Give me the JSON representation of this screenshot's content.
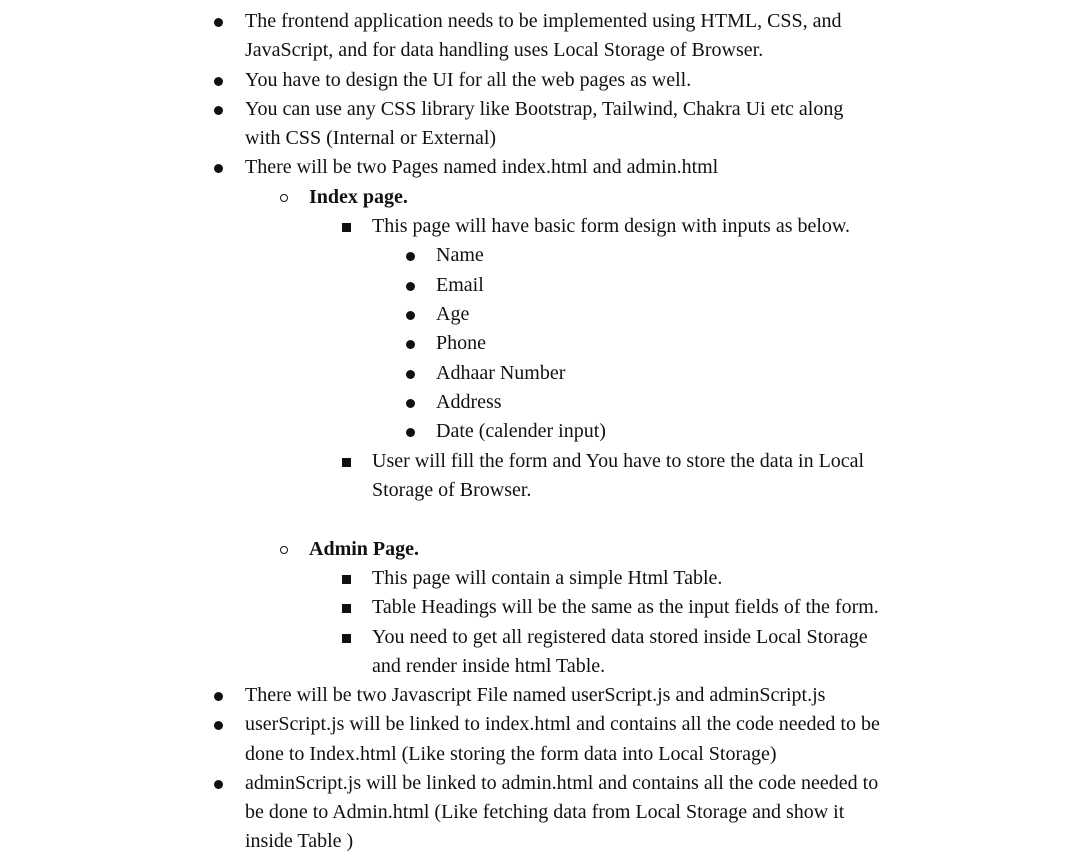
{
  "items": [
    {
      "lines": [
        "The frontend application needs to be implemented using HTML, CSS, and",
        "JavaScript, and for data handling uses Local Storage of Browser."
      ]
    },
    {
      "lines": [
        "You have to design the UI for all the web pages as well."
      ]
    },
    {
      "lines": [
        "You can use any CSS library like Bootstrap, Tailwind, Chakra Ui etc along",
        "with CSS (Internal or External)"
      ]
    },
    {
      "lines": [
        "There will be two Pages named index.html and admin.html"
      ]
    },
    {
      "lines": [
        "Index page."
      ]
    },
    {
      "lines": [
        "This page will have basic form design with inputs as below."
      ]
    },
    {
      "lines": [
        "Name"
      ]
    },
    {
      "lines": [
        "Email"
      ]
    },
    {
      "lines": [
        "Age"
      ]
    },
    {
      "lines": [
        "Phone"
      ]
    },
    {
      "lines": [
        "Adhaar Number"
      ]
    },
    {
      "lines": [
        "Address"
      ]
    },
    {
      "lines": [
        "Date (calender input)"
      ]
    },
    {
      "lines": [
        "User will fill the form and You have to store the data in Local",
        "Storage of Browser."
      ]
    },
    {
      "lines": [
        "Admin Page."
      ]
    },
    {
      "lines": [
        "This page will contain a simple Html Table."
      ]
    },
    {
      "lines": [
        "Table Headings will be the same as the input fields of the form."
      ]
    },
    {
      "lines": [
        "You need to get all registered data stored inside Local Storage",
        "and render inside html Table."
      ]
    },
    {
      "lines": [
        "There will be two Javascript File named userScript.js and adminScript.js"
      ]
    },
    {
      "lines": [
        "userScript.js will be linked to index.html and contains all the code needed to be",
        "done to Index.html (Like storing the form data into Local Storage)"
      ]
    },
    {
      "lines": [
        "adminScript.js will be linked to admin.html and contains all the code needed to",
        "be done to Admin.html (Like fetching data from Local Storage and show it",
        "inside Table )"
      ]
    }
  ]
}
